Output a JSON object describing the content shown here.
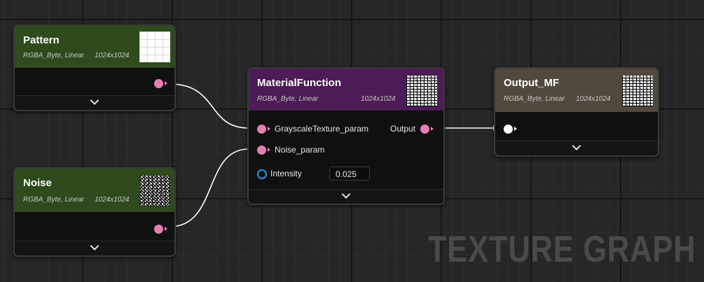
{
  "nodes": {
    "pattern": {
      "title": "Pattern",
      "format": "RGBA_Byte, Linear",
      "resolution": "1024x1024",
      "header_color": "#2f4a1c",
      "thumbnail": "grid-texture"
    },
    "noise": {
      "title": "Noise",
      "format": "RGBA_Byte, Linear",
      "resolution": "1024x1024",
      "header_color": "#2f4a1c",
      "thumbnail": "noise-texture"
    },
    "material_function": {
      "title": "MaterialFunction",
      "format": "RGBA_Byte, Linear",
      "resolution": "1024x1024",
      "header_color": "#4d1b55",
      "thumbnail": "noise-texture",
      "inputs": [
        {
          "label": "GrayscaleTexture_param"
        },
        {
          "label": "Noise_param"
        }
      ],
      "output_label": "Output",
      "intensity_label": "Intensity",
      "intensity_value": "0.025"
    },
    "output_mf": {
      "title": "Output_MF",
      "format": "RGBA_Byte, Linear",
      "resolution": "1024x1024",
      "header_color": "#51493d",
      "thumbnail": "noise-texture"
    }
  },
  "watermark": "TEXTURE GRAPH",
  "colors": {
    "texture_pin": "#e57fb2",
    "scalar_pin": "#1e9bf0",
    "wire": "#ffffff",
    "background": "#262626"
  }
}
